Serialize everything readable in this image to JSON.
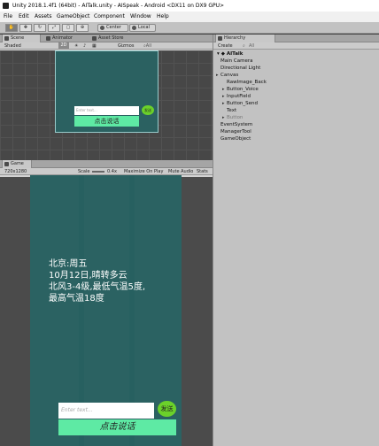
{
  "window": {
    "title": "Unity 2018.1.4f1 (64bit) - AITalk.unity - AISpeak - Android <DX11 on DX9 GPU>"
  },
  "menu": [
    "File",
    "Edit",
    "Assets",
    "GameObject",
    "Component",
    "Window",
    "Help"
  ],
  "toolbar": {
    "tools": [
      "hand-tool",
      "move-tool",
      "rotate-tool",
      "scale-tool",
      "rect-tool",
      "transform-tool"
    ],
    "pivot_label": "Center",
    "space_label": "Local"
  },
  "scene_panel": {
    "tabs": [
      "Scene",
      "Animator",
      "Asset Store"
    ],
    "shading_mode": "Shaded",
    "mode_2d": "2D",
    "gizmos_label": "Gizmos",
    "canvas": {
      "input_placeholder": "Enter text...",
      "send_label": "发送",
      "voice_label": "点击说话"
    }
  },
  "game_panel": {
    "tab": "Game",
    "resolution": "720x1280",
    "scale_label": "Scale",
    "scale_value": "0.4x",
    "toggles": [
      "Maximize On Play",
      "Mute Audio",
      "Stats"
    ],
    "canvas": {
      "weather_text": "北京:周五\n10月12日,晴转多云\n北风3-4级,最低气温5度,\n最高气温18度",
      "input_placeholder": "Enter text...",
      "send_label": "发送",
      "voice_label": "点击说话"
    }
  },
  "hierarchy": {
    "tab": "Hierarchy",
    "create_label": "Create",
    "search_placeholder": "All",
    "scene_name": "AITalk",
    "items": [
      {
        "label": "Main Camera",
        "depth": 1,
        "expandable": false,
        "dim": false
      },
      {
        "label": "Directional Light",
        "depth": 1,
        "expandable": false,
        "dim": false
      },
      {
        "label": "Canvas",
        "depth": 1,
        "expandable": true,
        "dim": false
      },
      {
        "label": "RawImage_Back",
        "depth": 2,
        "expandable": false,
        "dim": false
      },
      {
        "label": "Button_Voice",
        "depth": 2,
        "expandable": true,
        "dim": false
      },
      {
        "label": "InputField",
        "depth": 2,
        "expandable": true,
        "dim": false
      },
      {
        "label": "Button_Send",
        "depth": 2,
        "expandable": true,
        "dim": false
      },
      {
        "label": "Text",
        "depth": 2,
        "expandable": false,
        "dim": false
      },
      {
        "label": "Button",
        "depth": 2,
        "expandable": true,
        "dim": true
      },
      {
        "label": "EventSystem",
        "depth": 1,
        "expandable": false,
        "dim": false
      },
      {
        "label": "ManagerTool",
        "depth": 1,
        "expandable": false,
        "dim": false
      },
      {
        "label": "GameObject",
        "depth": 1,
        "expandable": false,
        "dim": false
      }
    ]
  }
}
